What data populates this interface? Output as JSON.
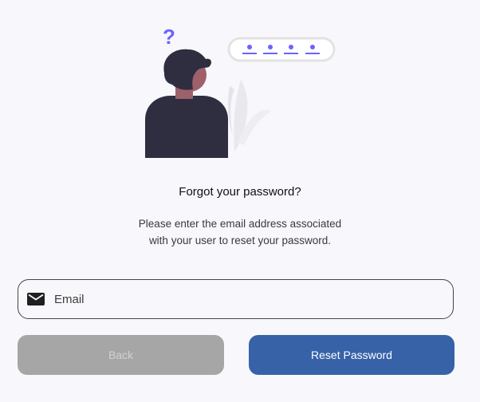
{
  "forgot_password": {
    "title": "Forgot your password?",
    "description_line1": "Please enter the email address associated",
    "description_line2": "with your user to reset your password.",
    "question_mark": "?"
  },
  "email_field": {
    "value": "",
    "placeholder": "Email",
    "icon": "mail-icon"
  },
  "buttons": {
    "back_label": "Back",
    "reset_label": "Reset Password"
  },
  "colors": {
    "accent": "#3762a8",
    "disabled_button": "#a6a6a6",
    "illustration_purple": "#6c63ff",
    "person_dark": "#2f2e41",
    "skin": "#9e616a",
    "background": "#f8f7fb"
  }
}
